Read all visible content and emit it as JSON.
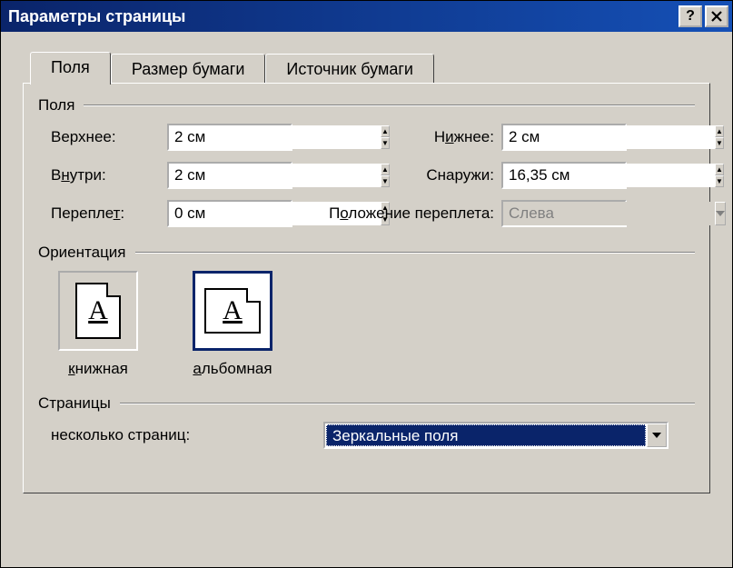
{
  "title": "Параметры страницы",
  "tabs": {
    "margins": "Поля",
    "paper": "Размер бумаги",
    "source": "Источник бумаги"
  },
  "groups": {
    "margins": "Поля",
    "orientation": "Ориентация",
    "pages": "Страницы"
  },
  "margins": {
    "top_label": "Верхнее:",
    "top_value": "2 см",
    "bottom_label_pre": "Н",
    "bottom_label_u": "и",
    "bottom_label_post": "жнее:",
    "bottom_value": "2 см",
    "inside_label_pre": "В",
    "inside_label_u": "н",
    "inside_label_post": "утри:",
    "inside_value": "2 см",
    "outside_label": "Снаружи:",
    "outside_value": "16,35 см",
    "gutter_label_pre": "Перепле",
    "gutter_label_u": "т",
    "gutter_label_post": ":",
    "gutter_value": "0 см",
    "gutter_pos_label_pre": "П",
    "gutter_pos_label_u": "о",
    "gutter_pos_label_post": "ложение переплета:",
    "gutter_pos_value": "Слева"
  },
  "orientation": {
    "portrait_pre": "",
    "portrait_u": "к",
    "portrait_post": "нижная",
    "landscape_pre": "",
    "landscape_u": "а",
    "landscape_post": "льбомная"
  },
  "pages": {
    "multi_label": "несколько страниц:",
    "multi_value": "Зеркальные поля"
  }
}
